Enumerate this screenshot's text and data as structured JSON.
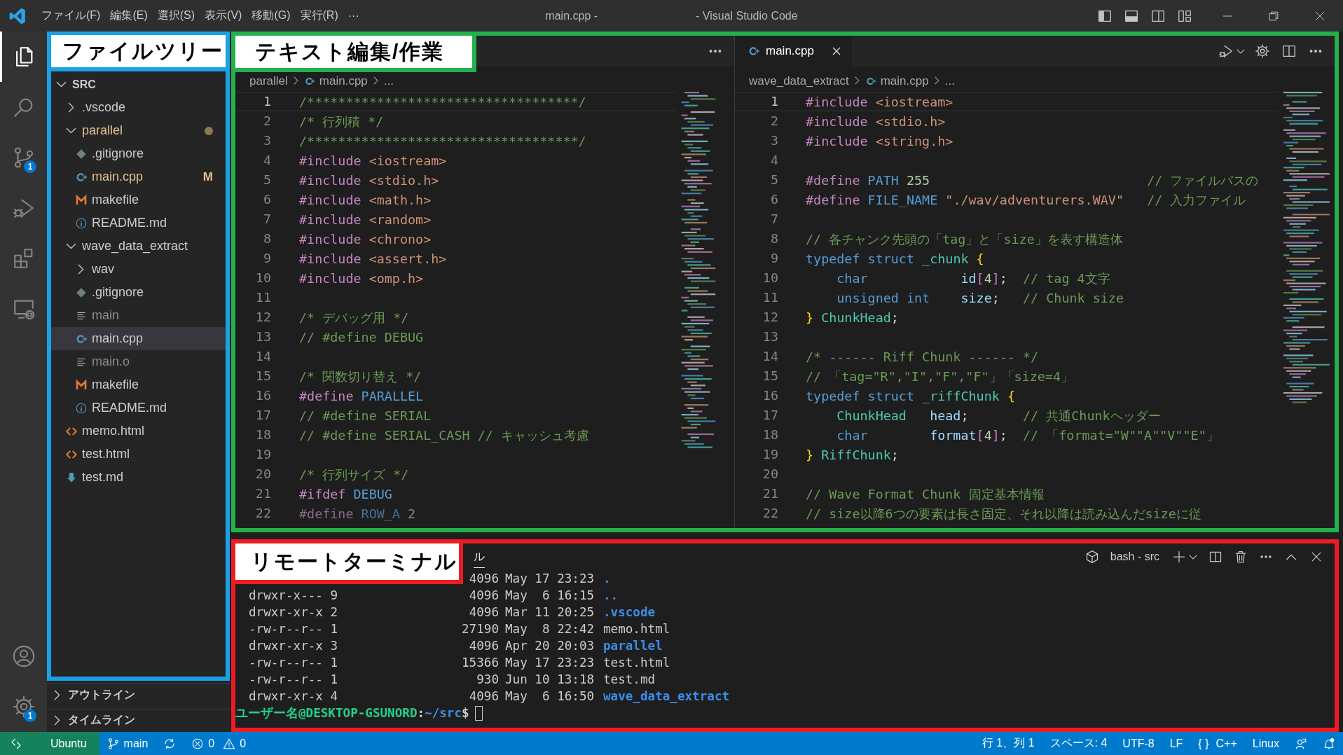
{
  "title_bar": {
    "menus": [
      "ファイル(F)",
      "編集(E)",
      "選択(S)",
      "表示(V)",
      "移動(G)",
      "実行(R)"
    ],
    "overflow": "···",
    "title": [
      "main.cpp -",
      "- Visual Studio Code"
    ]
  },
  "activity_bar": {
    "top": [
      {
        "kind": "explorer",
        "selected": true
      },
      {
        "kind": "search",
        "selected": false
      },
      {
        "kind": "source-control",
        "selected": false,
        "badge": "1"
      },
      {
        "kind": "run-debug",
        "selected": false
      },
      {
        "kind": "extensions",
        "selected": false
      },
      {
        "kind": "remote-explorer",
        "selected": false
      }
    ],
    "bottom": [
      {
        "kind": "account",
        "selected": false
      },
      {
        "kind": "settings",
        "selected": false,
        "badge": "1"
      }
    ]
  },
  "sidebar": {
    "callout": "ファイルツリー",
    "tree": [
      {
        "label": "SRC",
        "kind": "root",
        "expanded": true,
        "selected": false,
        "modified": false,
        "ignored": false,
        "children": [
          {
            "label": ".vscode",
            "kind": "folder",
            "expanded": false,
            "selected": false,
            "modified": false,
            "ignored": false
          },
          {
            "label": "parallel",
            "kind": "folder",
            "expanded": true,
            "selected": false,
            "modified": true,
            "ignored": false,
            "children": [
              {
                "label": ".gitignore",
                "kind": "gitignore",
                "selected": false,
                "modified": false,
                "ignored": false
              },
              {
                "label": "main.cpp",
                "kind": "cpp",
                "selected": false,
                "modified": true,
                "ignored": false,
                "badge": "M"
              },
              {
                "label": "makefile",
                "kind": "makefile",
                "selected": false,
                "modified": false,
                "ignored": false
              },
              {
                "label": "README.md",
                "kind": "info",
                "selected": false,
                "modified": false,
                "ignored": false
              }
            ]
          },
          {
            "label": "wave_data_extract",
            "kind": "folder",
            "expanded": true,
            "selected": false,
            "modified": false,
            "ignored": false,
            "children": [
              {
                "label": "wav",
                "kind": "folder",
                "expanded": false,
                "selected": false,
                "modified": false,
                "ignored": false
              },
              {
                "label": ".gitignore",
                "kind": "gitignore",
                "selected": false,
                "modified": false,
                "ignored": false
              },
              {
                "label": "main",
                "kind": "binary",
                "selected": false,
                "modified": false,
                "ignored": true
              },
              {
                "label": "main.cpp",
                "kind": "cpp",
                "selected": true,
                "modified": false,
                "ignored": false
              },
              {
                "label": "main.o",
                "kind": "binary",
                "selected": false,
                "modified": false,
                "ignored": true
              },
              {
                "label": "makefile",
                "kind": "makefile",
                "selected": false,
                "modified": false,
                "ignored": false
              },
              {
                "label": "README.md",
                "kind": "info",
                "selected": false,
                "modified": false,
                "ignored": false
              }
            ]
          },
          {
            "label": "memo.html",
            "kind": "html",
            "selected": false,
            "modified": false,
            "ignored": false
          },
          {
            "label": "test.html",
            "kind": "html",
            "selected": false,
            "modified": false,
            "ignored": false
          },
          {
            "label": "test.md",
            "kind": "markdown",
            "selected": false,
            "modified": false,
            "ignored": false
          }
        ]
      }
    ],
    "sections": [
      {
        "label": "アウトライン",
        "expanded": false
      },
      {
        "label": "タイムライン",
        "expanded": false
      }
    ]
  },
  "editor_area": {
    "callout": "テキスト編集/作業"
  },
  "editor_groups": [
    {
      "breadcrumbs": [
        {
          "kind": "folder",
          "text": "parallel"
        },
        {
          "kind": "cpp",
          "text": "main.cpp"
        },
        {
          "kind": "symbol",
          "text": "..."
        }
      ],
      "lines": [
        {
          "n": "1",
          "active": true,
          "tokens": [
            {
              "kind": "comment",
              "text": "/***********************************/"
            }
          ]
        },
        {
          "n": "2",
          "active": false,
          "tokens": [
            {
              "kind": "comment",
              "text": "/* 行列積 */"
            }
          ]
        },
        {
          "n": "3",
          "active": false,
          "tokens": [
            {
              "kind": "comment",
              "text": "/***********************************/"
            }
          ]
        },
        {
          "n": "4",
          "active": false,
          "tokens": [
            {
              "kind": "directive",
              "text": "#include"
            },
            {
              "kind": "string",
              "text": " <iostream>"
            }
          ]
        },
        {
          "n": "5",
          "active": false,
          "tokens": [
            {
              "kind": "directive",
              "text": "#include"
            },
            {
              "kind": "string",
              "text": " <stdio.h>"
            }
          ]
        },
        {
          "n": "6",
          "active": false,
          "tokens": [
            {
              "kind": "directive",
              "text": "#include"
            },
            {
              "kind": "string",
              "text": " <math.h>"
            }
          ]
        },
        {
          "n": "7",
          "active": false,
          "tokens": [
            {
              "kind": "directive",
              "text": "#include"
            },
            {
              "kind": "string",
              "text": " <random>"
            }
          ]
        },
        {
          "n": "8",
          "active": false,
          "tokens": [
            {
              "kind": "directive",
              "text": "#include"
            },
            {
              "kind": "string",
              "text": " <chrono>"
            }
          ]
        },
        {
          "n": "9",
          "active": false,
          "tokens": [
            {
              "kind": "directive",
              "text": "#include"
            },
            {
              "kind": "string",
              "text": " <assert.h>"
            }
          ]
        },
        {
          "n": "10",
          "active": false,
          "tokens": [
            {
              "kind": "directive",
              "text": "#include"
            },
            {
              "kind": "string",
              "text": " <omp.h>"
            }
          ]
        },
        {
          "n": "11",
          "active": false
        },
        {
          "n": "12",
          "active": false,
          "tokens": [
            {
              "kind": "comment",
              "text": "/* デバッグ用 */"
            }
          ]
        },
        {
          "n": "13",
          "active": false,
          "tokens": [
            {
              "kind": "comment",
              "text": "// #define DEBUG"
            }
          ]
        },
        {
          "n": "14",
          "active": false
        },
        {
          "n": "15",
          "active": false,
          "tokens": [
            {
              "kind": "comment",
              "text": "/* 関数切り替え */"
            }
          ]
        },
        {
          "n": "16",
          "active": false,
          "tokens": [
            {
              "kind": "directive",
              "text": "#define"
            },
            {
              "kind": "macro",
              "text": " PARALLEL"
            }
          ]
        },
        {
          "n": "17",
          "active": false,
          "tokens": [
            {
              "kind": "comment",
              "text": "// #define SERIAL"
            }
          ]
        },
        {
          "n": "18",
          "active": false,
          "tokens": [
            {
              "kind": "comment",
              "text": "// #define SERIAL_CASH // キャッシュ考慮"
            }
          ]
        },
        {
          "n": "19",
          "active": false
        },
        {
          "n": "20",
          "active": false,
          "tokens": [
            {
              "kind": "comment",
              "text": "/* 行列サイズ */"
            }
          ]
        },
        {
          "n": "21",
          "active": false,
          "tokens": [
            {
              "kind": "directive",
              "text": "#ifdef"
            },
            {
              "kind": "macro",
              "text": " DEBUG"
            }
          ]
        },
        {
          "n": "22",
          "active": false,
          "tokens": [
            {
              "kind": "inactive-directive",
              "text": "#define"
            },
            {
              "kind": "inactive-macro",
              "text": " ROW_A"
            },
            {
              "kind": "inactive-number",
              "text": " 2"
            }
          ]
        }
      ]
    },
    {
      "tabs": [
        {
          "kind": "cpp",
          "label": "main.cpp",
          "selected": true
        }
      ],
      "breadcrumbs": [
        {
          "kind": "folder",
          "text": "wave_data_extract"
        },
        {
          "kind": "cpp",
          "text": "main.cpp"
        },
        {
          "kind": "symbol",
          "text": "..."
        }
      ],
      "lines": [
        {
          "n": "1",
          "active": true,
          "tokens": [
            {
              "kind": "directive",
              "text": "#include"
            },
            {
              "kind": "string",
              "text": " <iostream>"
            }
          ]
        },
        {
          "n": "2",
          "active": false,
          "tokens": [
            {
              "kind": "directive",
              "text": "#include"
            },
            {
              "kind": "string",
              "text": " <stdio.h>"
            }
          ]
        },
        {
          "n": "3",
          "active": false,
          "tokens": [
            {
              "kind": "directive",
              "text": "#include"
            },
            {
              "kind": "string",
              "text": " <string.h>"
            }
          ]
        },
        {
          "n": "4",
          "active": false
        },
        {
          "n": "5",
          "active": false,
          "tokens": [
            {
              "kind": "directive",
              "text": "#define"
            },
            {
              "kind": "macro",
              "text": " PATH"
            },
            {
              "kind": "number",
              "text": " 255"
            },
            {
              "kind": "comment",
              "text": "                            // ファイルパスの"
            }
          ]
        },
        {
          "n": "6",
          "active": false,
          "tokens": [
            {
              "kind": "directive",
              "text": "#define"
            },
            {
              "kind": "macro",
              "text": " FILE_NAME"
            },
            {
              "kind": "string",
              "text": " \"./wav/adventurers.WAV\""
            },
            {
              "kind": "comment",
              "text": "   // 入力ファイル"
            }
          ]
        },
        {
          "n": "7",
          "active": false
        },
        {
          "n": "8",
          "active": false,
          "tokens": [
            {
              "kind": "comment",
              "text": "// 各チャンク先頭の「tag」と「size」を表す構造体"
            }
          ]
        },
        {
          "n": "9",
          "active": false,
          "tokens": [
            {
              "kind": "keyword",
              "text": "typedef struct"
            },
            {
              "kind": "type",
              "text": " _chunk"
            },
            {
              "kind": "bracket",
              "text": " {"
            }
          ]
        },
        {
          "n": "10",
          "active": false,
          "tokens": [
            {
              "kind": "keyword",
              "text": "    char"
            },
            {
              "kind": "variable",
              "text": "            id"
            },
            {
              "kind": "square",
              "text": "["
            },
            {
              "kind": "number",
              "text": "4"
            },
            {
              "kind": "square",
              "text": "]"
            },
            {
              "kind": "plain",
              "text": ";"
            },
            {
              "kind": "comment",
              "text": "  // tag 4文字"
            }
          ]
        },
        {
          "n": "11",
          "active": false,
          "tokens": [
            {
              "kind": "keyword",
              "text": "    unsigned int"
            },
            {
              "kind": "variable",
              "text": "    size"
            },
            {
              "kind": "plain",
              "text": ";"
            },
            {
              "kind": "comment",
              "text": "   // Chunk size"
            }
          ]
        },
        {
          "n": "12",
          "active": false,
          "tokens": [
            {
              "kind": "bracket",
              "text": "}"
            },
            {
              "kind": "type",
              "text": " ChunkHead"
            },
            {
              "kind": "plain",
              "text": ";"
            }
          ]
        },
        {
          "n": "13",
          "active": false
        },
        {
          "n": "14",
          "active": false,
          "tokens": [
            {
              "kind": "comment",
              "text": "/* ------ Riff Chunk ------ */"
            }
          ]
        },
        {
          "n": "15",
          "active": false,
          "tokens": [
            {
              "kind": "comment",
              "text": "// 「tag=\"R\",\"I\",\"F\",\"F\"」「size=4」"
            }
          ]
        },
        {
          "n": "16",
          "active": false,
          "tokens": [
            {
              "kind": "keyword",
              "text": "typedef struct"
            },
            {
              "kind": "type",
              "text": " _riffChunk"
            },
            {
              "kind": "bracket",
              "text": " {"
            }
          ]
        },
        {
          "n": "17",
          "active": false,
          "tokens": [
            {
              "kind": "type",
              "text": "    ChunkHead"
            },
            {
              "kind": "variable",
              "text": "   head"
            },
            {
              "kind": "plain",
              "text": ";"
            },
            {
              "kind": "comment",
              "text": "       // 共通Chunkヘッダー"
            }
          ]
        },
        {
          "n": "18",
          "active": false,
          "tokens": [
            {
              "kind": "keyword",
              "text": "    char"
            },
            {
              "kind": "variable",
              "text": "        format"
            },
            {
              "kind": "square",
              "text": "["
            },
            {
              "kind": "number",
              "text": "4"
            },
            {
              "kind": "square",
              "text": "]"
            },
            {
              "kind": "plain",
              "text": ";"
            },
            {
              "kind": "comment",
              "text": "  // 「format=\"W\"\"A\"\"V\"\"E\"」"
            }
          ]
        },
        {
          "n": "19",
          "active": false,
          "tokens": [
            {
              "kind": "bracket",
              "text": "}"
            },
            {
              "kind": "type",
              "text": " RiffChunk"
            },
            {
              "kind": "plain",
              "text": ";"
            }
          ]
        },
        {
          "n": "20",
          "active": false
        },
        {
          "n": "21",
          "active": false,
          "tokens": [
            {
              "kind": "comment",
              "text": "// Wave Format Chunk 固定基本情報"
            }
          ]
        },
        {
          "n": "22",
          "active": false,
          "tokens": [
            {
              "kind": "comment",
              "text": "// size以降6つの要素は長さ固定、それ以降は読み込んだsizeに従"
            }
          ]
        }
      ]
    }
  ],
  "panel": {
    "callout": "リモートターミナル",
    "tabs": [
      {
        "label": "ル",
        "selected": true
      }
    ],
    "terminal_name": "bash - src",
    "lines": [
      {
        "size": "4096",
        "date": "May 17 23:23",
        "name": ".",
        "kind": "dir"
      },
      {
        "perms": "drwxr-x--- 9",
        "size": "4096",
        "date": "May  6 16:15",
        "name": "..",
        "kind": "dir"
      },
      {
        "perms": "drwxr-xr-x 2",
        "size": "4096",
        "date": "Mar 11 20:25",
        "name": ".vscode",
        "kind": "dir"
      },
      {
        "perms": "-rw-r--r-- 1",
        "size": "27190",
        "date": "May  8 22:42",
        "name": "memo.html",
        "kind": "file"
      },
      {
        "perms": "drwxr-xr-x 3",
        "size": "4096",
        "date": "Apr 20 20:03",
        "name": "parallel",
        "kind": "dir"
      },
      {
        "perms": "-rw-r--r-- 1",
        "size": "15366",
        "date": "May 17 23:23",
        "name": "test.html",
        "kind": "file"
      },
      {
        "perms": "-rw-r--r-- 1",
        "size": "930",
        "date": "Jun 10 13:18",
        "name": "test.md",
        "kind": "file"
      },
      {
        "perms": "drwxr-xr-x 4",
        "size": "4096",
        "date": "May  6 16:50",
        "name": "wave_data_extract",
        "kind": "dir"
      }
    ],
    "prompt": {
      "user_host": "ユーザー名@DESKTOP-GSUNORD",
      "separator": ":",
      "path": "~/src",
      "symbol": "$"
    }
  },
  "status_bar": {
    "remote": {
      "label": "Ubuntu"
    },
    "left": [
      {
        "kind": "branch",
        "text": "main"
      },
      {
        "kind": "sync"
      },
      {
        "kind": "problems",
        "errors": "0",
        "warnings": "0"
      }
    ],
    "right": [
      {
        "kind": "text",
        "text": "行 1、列 1"
      },
      {
        "kind": "text",
        "text": "スペース: 4"
      },
      {
        "kind": "text",
        "text": "UTF-8"
      },
      {
        "kind": "text",
        "text": "LF"
      },
      {
        "kind": "language",
        "icon": "{ }",
        "text": "C++"
      },
      {
        "kind": "text",
        "text": "Linux"
      },
      {
        "kind": "feedback"
      },
      {
        "kind": "notifications"
      }
    ]
  }
}
